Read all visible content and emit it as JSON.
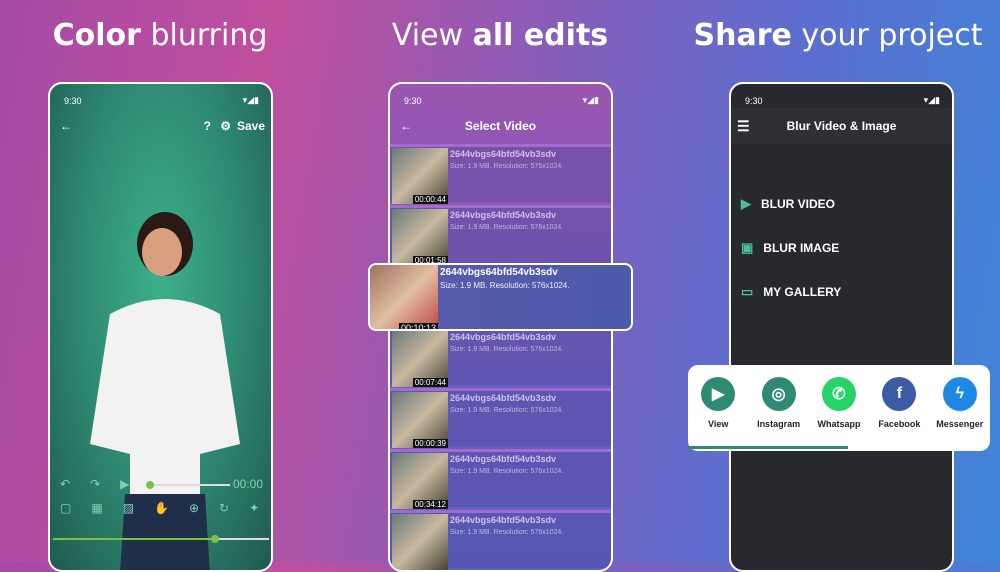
{
  "headings": [
    {
      "bold": "Color",
      "rest": " blurring"
    },
    {
      "rest": "View ",
      "bold": "all edits"
    },
    {
      "bold": "Share",
      "rest": " your project"
    }
  ],
  "status_time": "9:30",
  "editor": {
    "save": "Save",
    "timer": "00:00",
    "progress": 0.75,
    "seek": 0.05
  },
  "select": {
    "title": "Select Video",
    "items": [
      {
        "name": "2644vbgs64bfd54vb3sdv",
        "info": "Size: 1.9 MB. Resolution: 576x1024.",
        "duration": "00:00:44"
      },
      {
        "name": "2644vbgs64bfd54vb3sdv",
        "info": "Size: 1.9 MB. Resolution: 576x1024.",
        "duration": "00:01:58"
      },
      {
        "name": "2644vbgs64bfd54vb3sdv",
        "info": "Size: 1.9 MB. Resolution: 576x1024.",
        "duration": "00:10:13"
      },
      {
        "name": "2644vbgs64bfd54vb3sdv",
        "info": "Size: 1.9 MB. Resolution: 576x1024.",
        "duration": "00:07:44"
      },
      {
        "name": "2644vbgs64bfd54vb3sdv",
        "info": "Size: 1.9 MB. Resolution: 576x1024.",
        "duration": "00:00:39"
      },
      {
        "name": "2644vbgs64bfd54vb3sdv",
        "info": "Size: 1.9 MB. Resolution: 576x1024.",
        "duration": "00:34:12"
      },
      {
        "name": "2644vbgs64bfd54vb3sdv",
        "info": "Size: 1.9 MB. Resolution: 576x1024.",
        "duration": ""
      }
    ]
  },
  "home": {
    "title": "Blur Video & Image",
    "menu": [
      "BLUR VIDEO",
      "BLUR IMAGE",
      "MY GALLERY"
    ]
  },
  "share": [
    {
      "label": "View",
      "color": "#2f8a73"
    },
    {
      "label": "Instagram",
      "color": "#2f8a73"
    },
    {
      "label": "Whatsapp",
      "color": "#25d366"
    },
    {
      "label": "Facebook",
      "color": "#3b5ba5"
    },
    {
      "label": "Messenger",
      "color": "#1e88e5"
    }
  ]
}
